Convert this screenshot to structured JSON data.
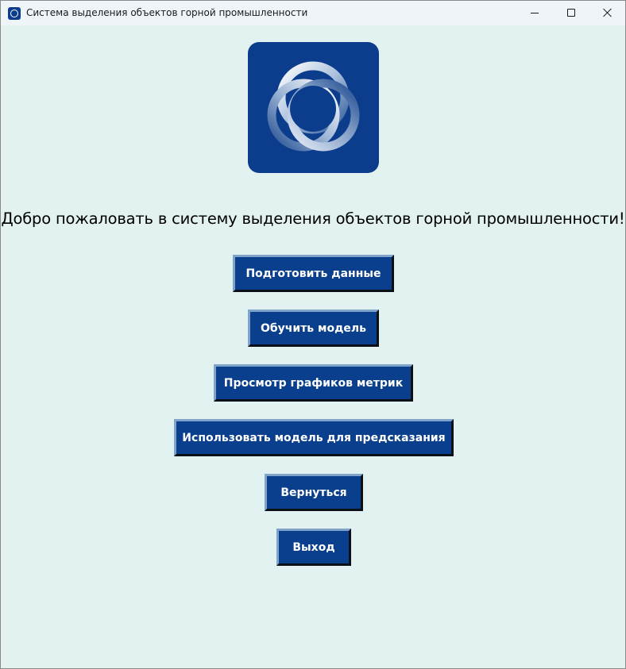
{
  "window": {
    "title": "Система выделения объектов горной промышленности",
    "controls": {
      "minimize_icon": "minimize-icon",
      "maximize_icon": "maximize-icon",
      "close_icon": "close-icon"
    }
  },
  "main": {
    "logo_icon": "interlocking-rings-logo",
    "welcome_text": "Добро пожаловать в систему выделения объектов горной промышленности!",
    "buttons": [
      {
        "label": "Подготовить данные"
      },
      {
        "label": "Обучить модель"
      },
      {
        "label": "Просмотр графиков метрик"
      },
      {
        "label": "Использовать модель для предсказания"
      },
      {
        "label": "Вернуться"
      },
      {
        "label": "Выход"
      }
    ]
  },
  "colors": {
    "background": "#e1f2f0",
    "button_fill": "#0a3f8d",
    "button_text": "#ffffff",
    "logo_background": "#0b3d8c"
  }
}
